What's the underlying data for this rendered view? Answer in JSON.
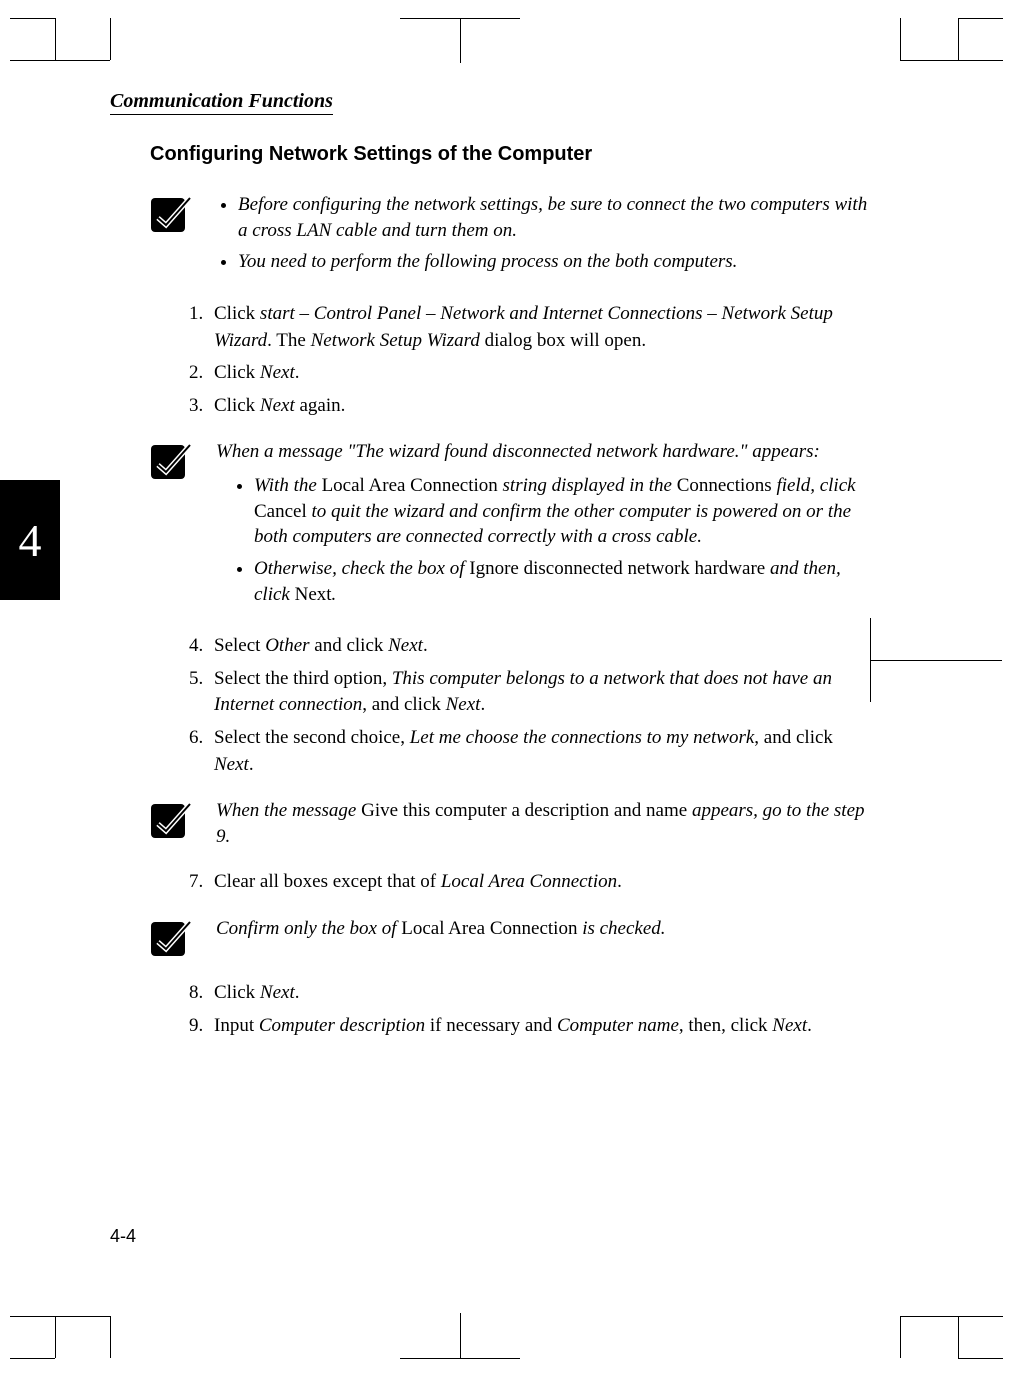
{
  "running_header": "Communication Functions",
  "chapter_tab": "4",
  "section_title": "Configuring Network Settings of the Computer",
  "note1": {
    "b1": "Before configuring the network settings, be sure to connect the two computers with a cross LAN cable and turn them on.",
    "b2": "You need to perform the following process on the both computers."
  },
  "steps_a": {
    "s1_pre": "Click ",
    "s1_i": "start – Control Panel – Network and Internet Connections – Network Setup Wizard",
    "s1_mid": ". The ",
    "s1_i2": "Network Setup Wizard",
    "s1_post": " dialog box will open.",
    "s2_pre": "Click ",
    "s2_i": "Next",
    "s2_post": ".",
    "s3_pre": "Click ",
    "s3_i": "Next",
    "s3_post": " again."
  },
  "note2": {
    "intro": "When a message \"The wizard found disconnected network hardware.\" appears:",
    "b1_i1": "With the ",
    "b1_r1": "Local Area Connection",
    "b1_i2": " string displayed in the ",
    "b1_r2": "Connections",
    "b1_i3": " field, click ",
    "b1_r3": "Cancel",
    "b1_i4": " to quit the wizard and confirm the other computer is powered on or the both computers are connected correctly with a cross cable.",
    "b2_i1": "Otherwise, check the box of ",
    "b2_r1": "Ignore disconnected network hardware",
    "b2_i2": " and then, click ",
    "b2_r2": "Next",
    "b2_i3": "."
  },
  "steps_b": {
    "s4_pre": "Select ",
    "s4_i1": "Other",
    "s4_mid": " and click ",
    "s4_i2": "Next",
    "s4_post": ".",
    "s5_pre": "Select the third option, ",
    "s5_i": "This computer belongs to a network that does not have an Internet connection",
    "s5_mid": ", and click ",
    "s5_i2": "Next",
    "s5_post": ".",
    "s6_pre": "Select the second choice, ",
    "s6_i": "Let me choose the connections to my network",
    "s6_mid": ", and click ",
    "s6_i2": "Next",
    "s6_post": "."
  },
  "note3": {
    "i1": "When the message ",
    "r1": "Give this computer a description and name",
    "i2": " appears, go to the step 9."
  },
  "steps_c": {
    "s7_pre": "Clear all boxes except that of ",
    "s7_i": "Local Area Connection",
    "s7_post": "."
  },
  "note4": {
    "i1": "Confirm only the box of ",
    "r1": "Local Area Connection",
    "i2": " is checked."
  },
  "steps_d": {
    "s8_pre": "Click ",
    "s8_i": "Next",
    "s8_post": ".",
    "s9_pre": "Input ",
    "s9_i1": "Computer description",
    "s9_mid1": " if necessary and ",
    "s9_i2": "Computer name",
    "s9_mid2": ", then, click ",
    "s9_i3": "Next",
    "s9_post": "."
  },
  "page_number": "4-4"
}
